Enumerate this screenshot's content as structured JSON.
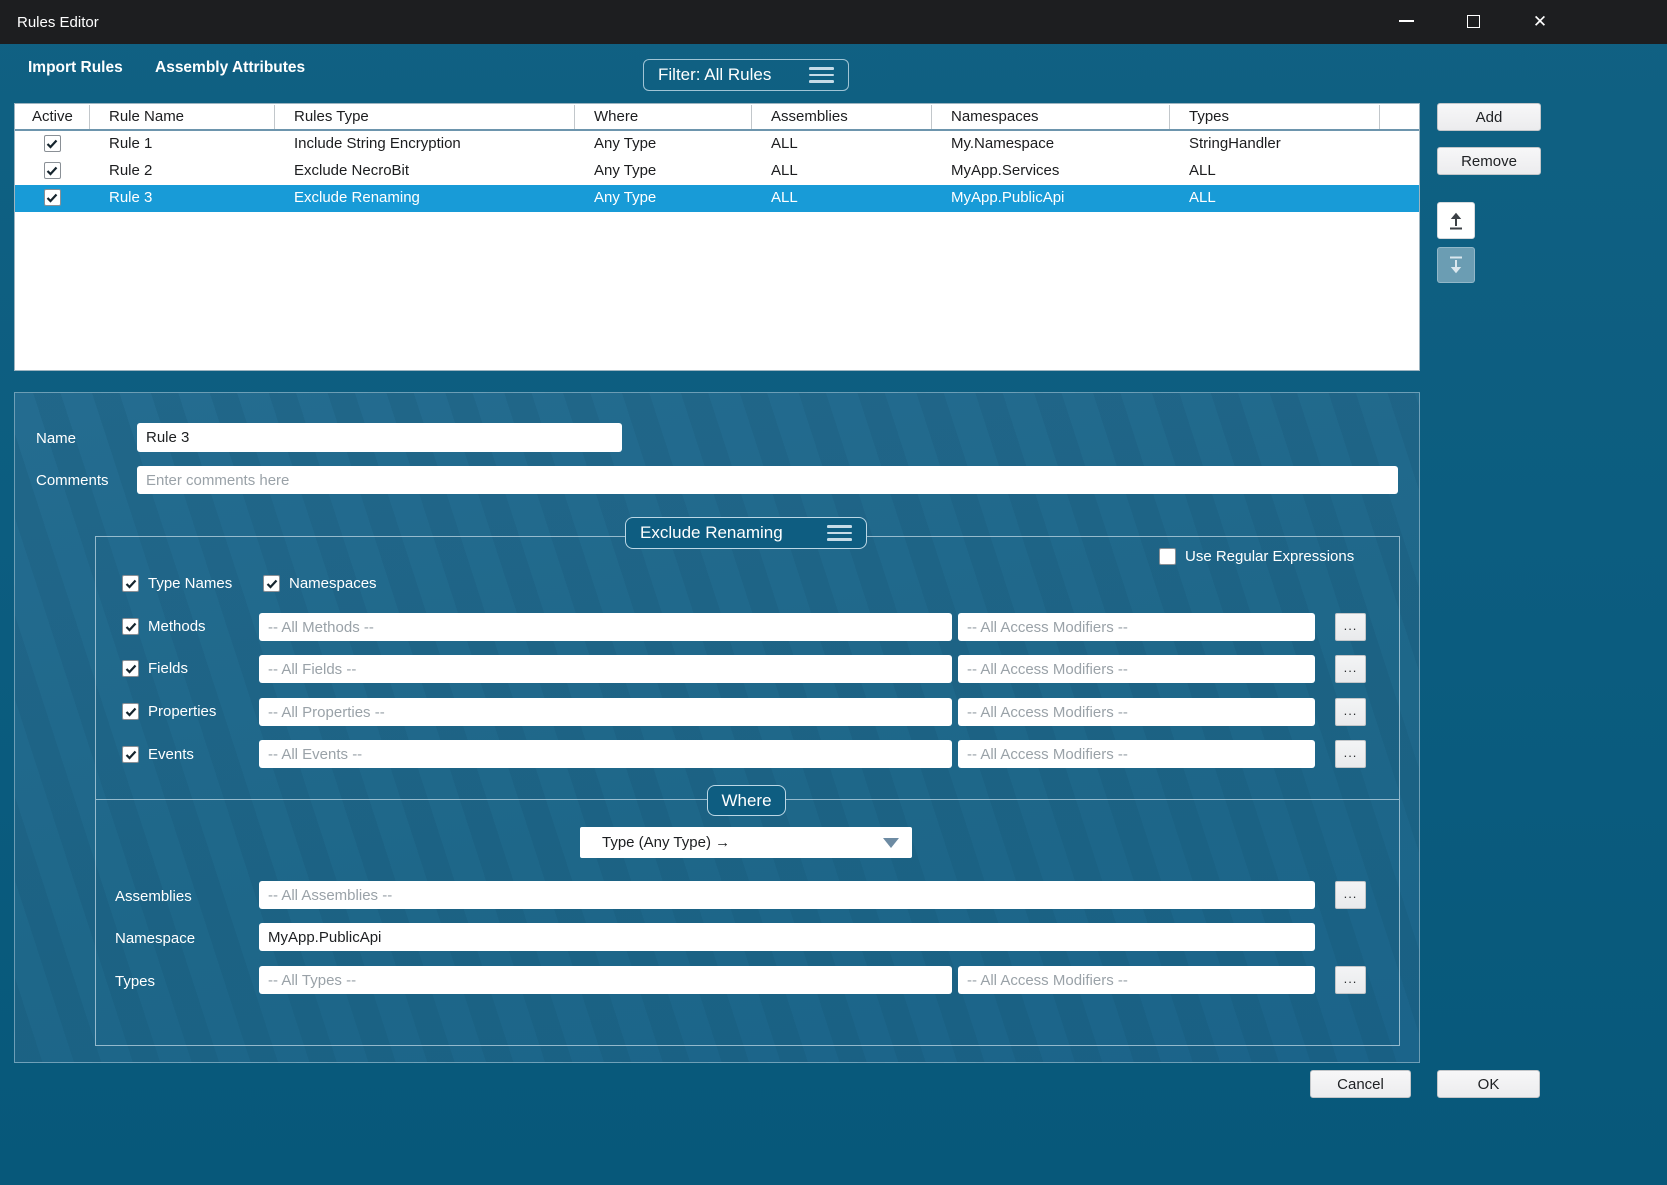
{
  "window": {
    "title": "Rules Editor"
  },
  "menu": {
    "import_rules": "Import Rules",
    "assembly_attributes": "Assembly Attributes"
  },
  "filter": {
    "label": "Filter: All Rules"
  },
  "table": {
    "headers": {
      "active": "Active",
      "name": "Rule Name",
      "type": "Rules Type",
      "where": "Where",
      "assemblies": "Assemblies",
      "namespaces": "Namespaces",
      "types": "Types"
    },
    "rows": [
      {
        "active": true,
        "selected": false,
        "name": "Rule 1",
        "type": "Include String Encryption",
        "where": "Any Type",
        "assemblies": "ALL",
        "namespaces": "My.Namespace",
        "types": "StringHandler"
      },
      {
        "active": true,
        "selected": false,
        "name": "Rule 2",
        "type": "Exclude NecroBit",
        "where": "Any Type",
        "assemblies": "ALL",
        "namespaces": "MyApp.Services",
        "types": "ALL"
      },
      {
        "active": true,
        "selected": true,
        "name": "Rule 3",
        "type": "Exclude Renaming",
        "where": "Any Type",
        "assemblies": "ALL",
        "namespaces": "MyApp.PublicApi",
        "types": "ALL"
      }
    ]
  },
  "side_actions": {
    "add": "Add",
    "remove": "Remove"
  },
  "details": {
    "name_label": "Name",
    "name_value": "Rule 3",
    "comments_label": "Comments",
    "comments_placeholder": "Enter comments here",
    "rule_type_selector": "Exclude Renaming",
    "use_regex": {
      "label": "Use Regular Expressions",
      "checked": false
    },
    "scope": {
      "type_names": {
        "label": "Type Names",
        "checked": true
      },
      "namespaces": {
        "label": "Namespaces",
        "checked": true
      }
    },
    "members": [
      {
        "label": "Methods",
        "checked": true,
        "placeholder": "-- All Methods --",
        "modifiers_placeholder": "-- All Access Modifiers --",
        "more": "..."
      },
      {
        "label": "Fields",
        "checked": true,
        "placeholder": "-- All Fields --",
        "modifiers_placeholder": "-- All Access Modifiers --",
        "more": "..."
      },
      {
        "label": "Properties",
        "checked": true,
        "placeholder": "-- All Properties --",
        "modifiers_placeholder": "-- All Access Modifiers --",
        "more": "..."
      },
      {
        "label": "Events",
        "checked": true,
        "placeholder": "-- All Events --",
        "modifiers_placeholder": "-- All Access Modifiers --",
        "more": "..."
      }
    ],
    "where": {
      "label": "Where",
      "type_selector": "Type (Any Type) →",
      "assemblies": {
        "label": "Assemblies",
        "placeholder": "-- All Assemblies --",
        "more": "..."
      },
      "namespace": {
        "label": "Namespace",
        "value": "MyApp.PublicApi"
      },
      "types": {
        "label": "Types",
        "placeholder": "-- All Types --",
        "modifiers_placeholder": "-- All Access Modifiers --",
        "more": "..."
      }
    }
  },
  "footer": {
    "cancel": "Cancel",
    "ok": "OK"
  },
  "colors": {
    "titlebar": "#1d1e20",
    "window_bg": "#0b5c7f",
    "panel_bg": "#216a8e",
    "selection": "#189bd7",
    "badge_bg": "#0e5d81",
    "placeholder": "#9aa2a8"
  }
}
